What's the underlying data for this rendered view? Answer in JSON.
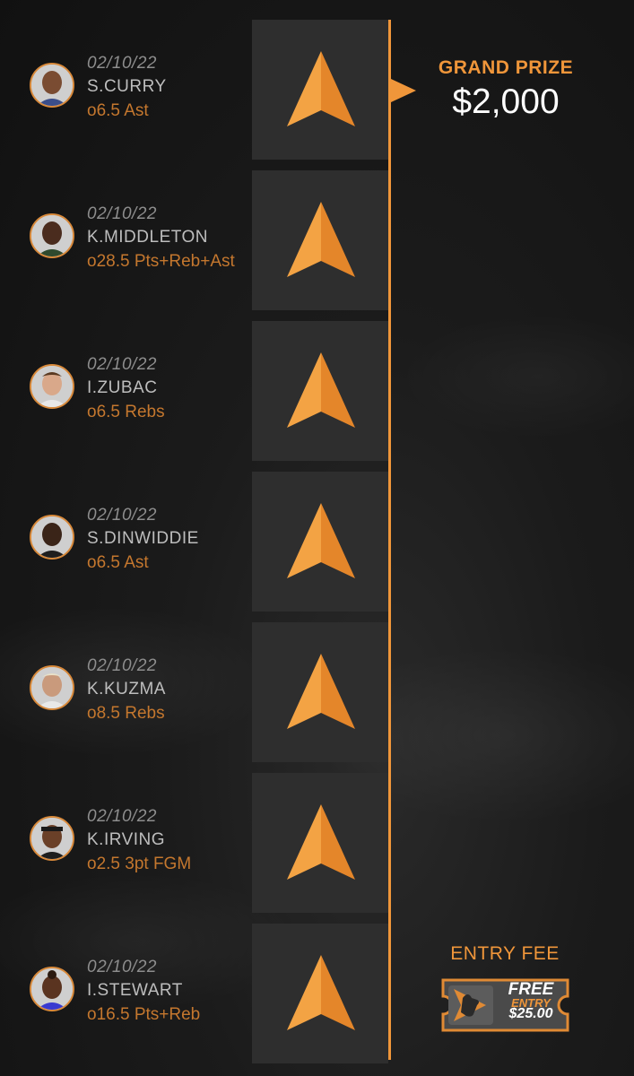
{
  "prize": {
    "title": "GRAND PRIZE",
    "amount": "$2,000"
  },
  "entry": {
    "title": "ENTRY FEE",
    "free_label": "FREE",
    "entry_label": "ENTRY",
    "value": "$25.00"
  },
  "picks": [
    {
      "date": "02/10/22",
      "player": "S.CURRY",
      "line": "o6.5 Ast",
      "direction": "up"
    },
    {
      "date": "02/10/22",
      "player": "K.MIDDLETON",
      "line": "o28.5 Pts+Reb+Ast",
      "direction": "up"
    },
    {
      "date": "02/10/22",
      "player": "I.ZUBAC",
      "line": "o6.5 Rebs",
      "direction": "up"
    },
    {
      "date": "02/10/22",
      "player": "S.DINWIDDIE",
      "line": "o6.5 Ast",
      "direction": "up"
    },
    {
      "date": "02/10/22",
      "player": "K.KUZMA",
      "line": "o8.5 Rebs",
      "direction": "up"
    },
    {
      "date": "02/10/22",
      "player": "K.IRVING",
      "line": "o2.5 3pt FGM",
      "direction": "up"
    },
    {
      "date": "02/10/22",
      "player": "I.STEWART",
      "line": "o16.5 Pts+Reb",
      "direction": "up"
    }
  ],
  "colors": {
    "accent": "#f0963a",
    "tile": "#2e2e2e",
    "line_text": "#c4772e"
  },
  "icons": {
    "pick_arrow": "up-arrow-icon",
    "avatar": "player-avatar",
    "ticket": "ticket-icon"
  }
}
